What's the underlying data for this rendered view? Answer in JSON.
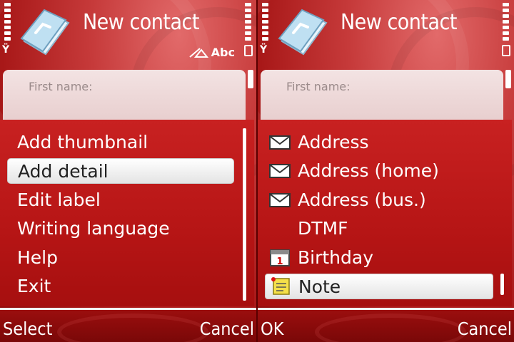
{
  "left_screen": {
    "title": "New contact",
    "input_mode": "Abc",
    "form": {
      "first_name_label": "First name:"
    },
    "options_menu": {
      "items": [
        {
          "label": "Add thumbnail",
          "selected": false
        },
        {
          "label": "Add detail",
          "selected": true
        },
        {
          "label": "Edit label",
          "selected": false
        },
        {
          "label": "Writing language",
          "selected": false
        },
        {
          "label": "Help",
          "selected": false
        },
        {
          "label": "Exit",
          "selected": false
        }
      ]
    },
    "softkeys": {
      "left": "Select",
      "right": "Cancel"
    }
  },
  "right_screen": {
    "title": "New contact",
    "form": {
      "first_name_label": "First name:"
    },
    "detail_menu": {
      "items": [
        {
          "label": "Address",
          "icon": "envelope-icon",
          "selected": false
        },
        {
          "label": "Address (home)",
          "icon": "envelope-icon",
          "selected": false
        },
        {
          "label": "Address (bus.)",
          "icon": "envelope-icon",
          "selected": false
        },
        {
          "label": "DTMF",
          "icon": "",
          "selected": false
        },
        {
          "label": "Birthday",
          "icon": "calendar-icon",
          "selected": false
        },
        {
          "label": "Note",
          "icon": "note-icon",
          "selected": true
        }
      ]
    },
    "softkeys": {
      "left": "OK",
      "right": "Cancel"
    }
  },
  "calendar_icon_day": "1",
  "colors": {
    "theme_red": "#b61515",
    "selection_bg": "#ffffff",
    "text_primary": "#ffffff"
  }
}
